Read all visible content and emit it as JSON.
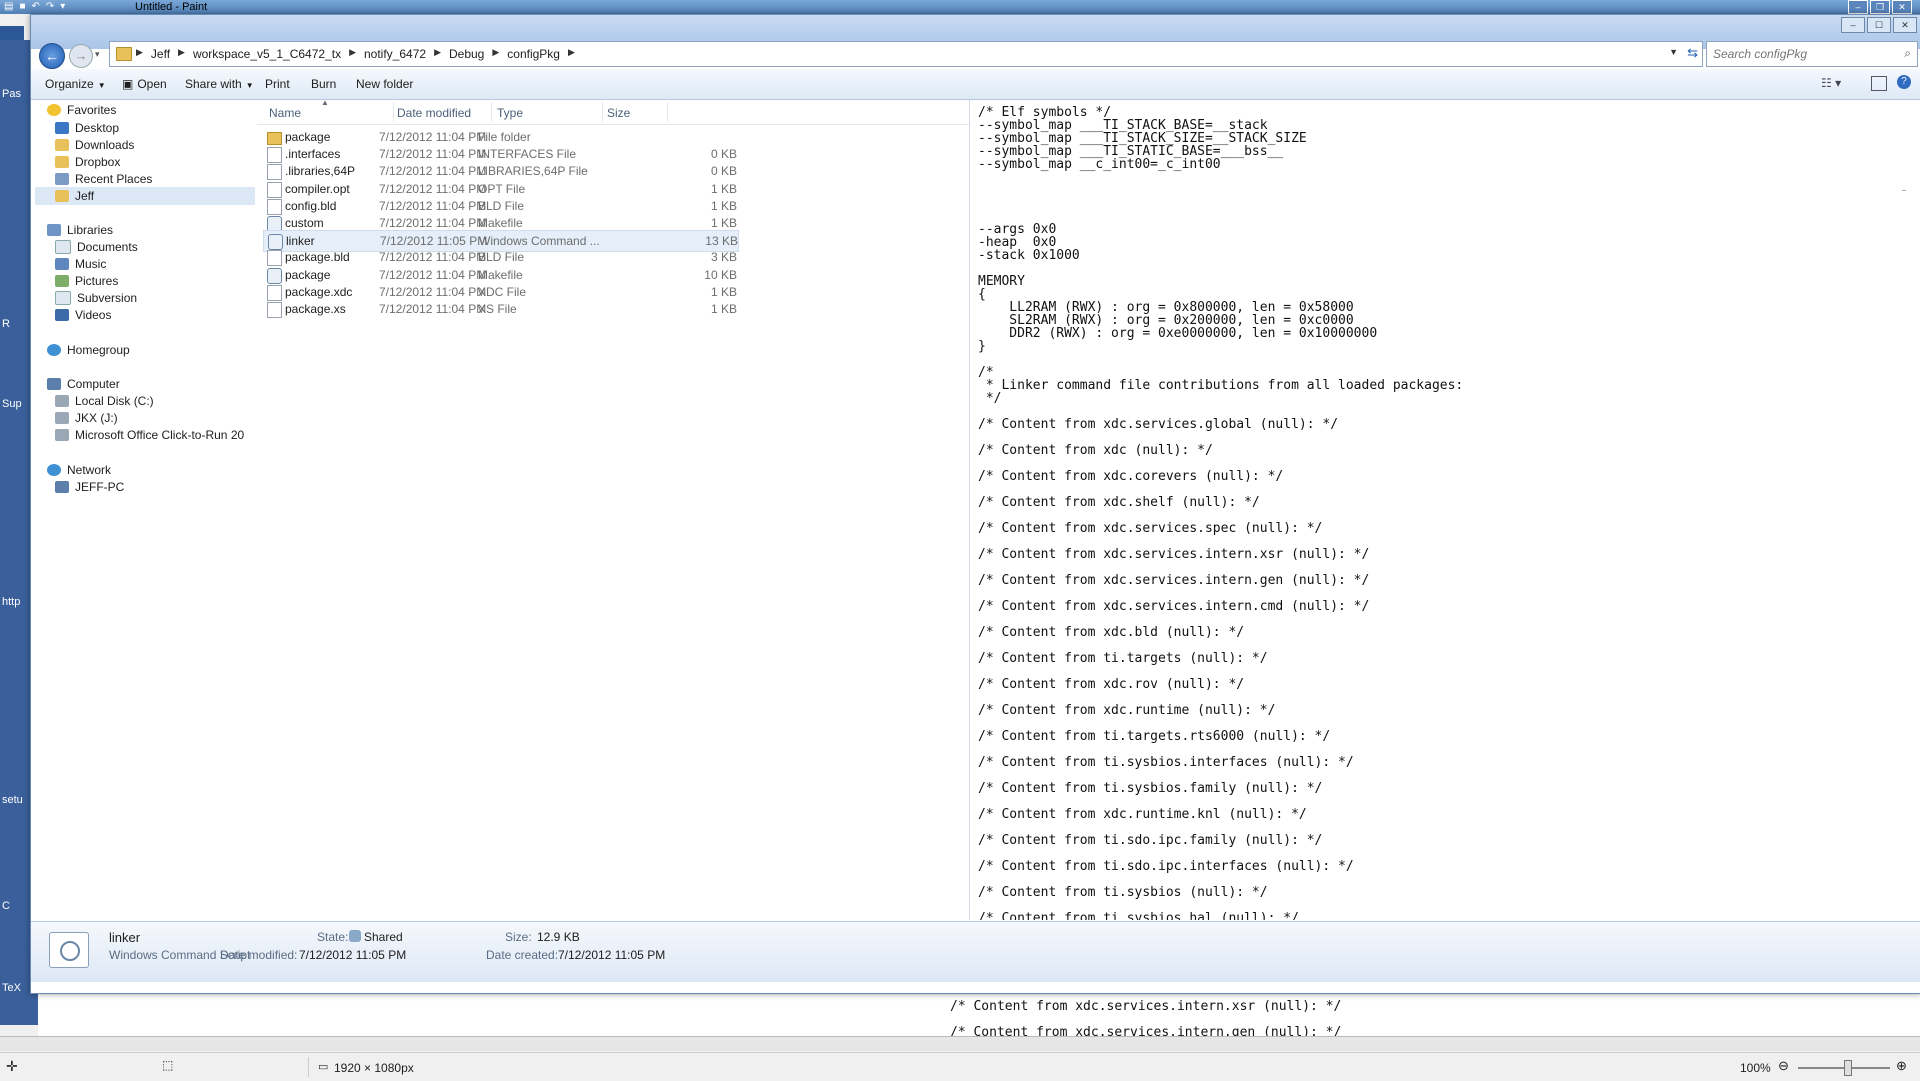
{
  "paint": {
    "title": "Untitled - Paint",
    "ribbon_tab": "",
    "strip_labels": [
      "Pas",
      "R",
      "Sup",
      "http",
      "setu",
      "C",
      "TeX"
    ],
    "canvas_lines": [
      "/* Content from xdc.services.intern.xsr (null): */",
      "/* Content from xdc.services.intern.gen (null): */"
    ],
    "status": {
      "dimensions": "1920 × 1080px",
      "zoom": "100%"
    }
  },
  "explorer": {
    "breadcrumbs": [
      "Jeff",
      "workspace_v5_1_C6472_tx",
      "notify_6472",
      "Debug",
      "configPkg"
    ],
    "search_placeholder": "Search configPkg",
    "toolbar": {
      "organize": "Organize",
      "open": "Open",
      "share_with": "Share with",
      "print": "Print",
      "burn": "Burn",
      "new_folder": "New folder"
    },
    "nav": {
      "favorites": "Favorites",
      "favorites_items": [
        "Desktop",
        "Downloads",
        "Dropbox",
        "Recent Places",
        "Jeff"
      ],
      "libraries": "Libraries",
      "libraries_items": [
        "Documents",
        "Music",
        "Pictures",
        "Subversion",
        "Videos"
      ],
      "homegroup": "Homegroup",
      "computer": "Computer",
      "computer_items": [
        "Local Disk (C:)",
        "JKX (J:)",
        "Microsoft Office Click-to-Run 20"
      ],
      "network": "Network",
      "network_items": [
        "JEFF-PC"
      ]
    },
    "columns": {
      "name": "Name",
      "date": "Date modified",
      "type": "Type",
      "size": "Size"
    },
    "files": [
      {
        "name": "package",
        "date": "7/12/2012 11:04 PM",
        "type": "File folder",
        "size": "",
        "icon": "folder"
      },
      {
        "name": ".interfaces",
        "date": "7/12/2012 11:04 PM",
        "type": "INTERFACES File",
        "size": "0 KB",
        "icon": "doc"
      },
      {
        "name": ".libraries,64P",
        "date": "7/12/2012 11:04 PM",
        "type": "LIBRARIES,64P File",
        "size": "0 KB",
        "icon": "doc"
      },
      {
        "name": "compiler.opt",
        "date": "7/12/2012 11:04 PM",
        "type": "OPT File",
        "size": "1 KB",
        "icon": "doc"
      },
      {
        "name": "config.bld",
        "date": "7/12/2012 11:04 PM",
        "type": "BLD File",
        "size": "1 KB",
        "icon": "doc"
      },
      {
        "name": "custom",
        "date": "7/12/2012 11:04 PM",
        "type": "Makefile",
        "size": "1 KB",
        "icon": "gear"
      },
      {
        "name": "linker",
        "date": "7/12/2012 11:05 PM",
        "type": "Windows Command ...",
        "size": "13 KB",
        "icon": "gear"
      },
      {
        "name": "package.bld",
        "date": "7/12/2012 11:04 PM",
        "type": "BLD File",
        "size": "3 KB",
        "icon": "doc"
      },
      {
        "name": "package",
        "date": "7/12/2012 11:04 PM",
        "type": "Makefile",
        "size": "10 KB",
        "icon": "gear"
      },
      {
        "name": "package.xdc",
        "date": "7/12/2012 11:04 PM",
        "type": "XDC File",
        "size": "1 KB",
        "icon": "doc"
      },
      {
        "name": "package.xs",
        "date": "7/12/2012 11:04 PM",
        "type": "XS File",
        "size": "1 KB",
        "icon": "doc"
      }
    ],
    "preview_text": "/* Elf symbols */\n--symbol_map ___TI_STACK_BASE=__stack\n--symbol_map ___TI_STACK_SIZE=__STACK_SIZE\n--symbol_map ___TI_STATIC_BASE=___bss__\n--symbol_map __c_int00=_c_int00\n\n\n\n\n--args 0x0\n-heap  0x0\n-stack 0x1000\n\nMEMORY\n{\n    LL2RAM (RWX) : org = 0x800000, len = 0x58000\n    SL2RAM (RWX) : org = 0x200000, len = 0xc0000\n    DDR2 (RWX) : org = 0xe0000000, len = 0x10000000\n}\n\n/*\n * Linker command file contributions from all loaded packages:\n */\n\n/* Content from xdc.services.global (null): */\n\n/* Content from xdc (null): */\n\n/* Content from xdc.corevers (null): */\n\n/* Content from xdc.shelf (null): */\n\n/* Content from xdc.services.spec (null): */\n\n/* Content from xdc.services.intern.xsr (null): */\n\n/* Content from xdc.services.intern.gen (null): */\n\n/* Content from xdc.services.intern.cmd (null): */\n\n/* Content from xdc.bld (null): */\n\n/* Content from ti.targets (null): */\n\n/* Content from xdc.rov (null): */\n\n/* Content from xdc.runtime (null): */\n\n/* Content from ti.targets.rts6000 (null): */\n\n/* Content from ti.sysbios.interfaces (null): */\n\n/* Content from ti.sysbios.family (null): */\n\n/* Content from xdc.runtime.knl (null): */\n\n/* Content from ti.sdo.ipc.family (null): */\n\n/* Content from ti.sdo.ipc.interfaces (null): */\n\n/* Content from ti.sysbios (null): */\n\n/* Content from ti.sysbios.hal (null): */",
    "details": {
      "name": "linker",
      "type": "Windows Command Script",
      "state_label": "State:",
      "state_value": "Shared",
      "size_label": "Size:",
      "size_value": "12.9 KB",
      "modified_label": "Date modified:",
      "modified_value": "7/12/2012 11:05 PM",
      "created_label": "Date created:",
      "created_value": "7/12/2012 11:05 PM"
    }
  }
}
